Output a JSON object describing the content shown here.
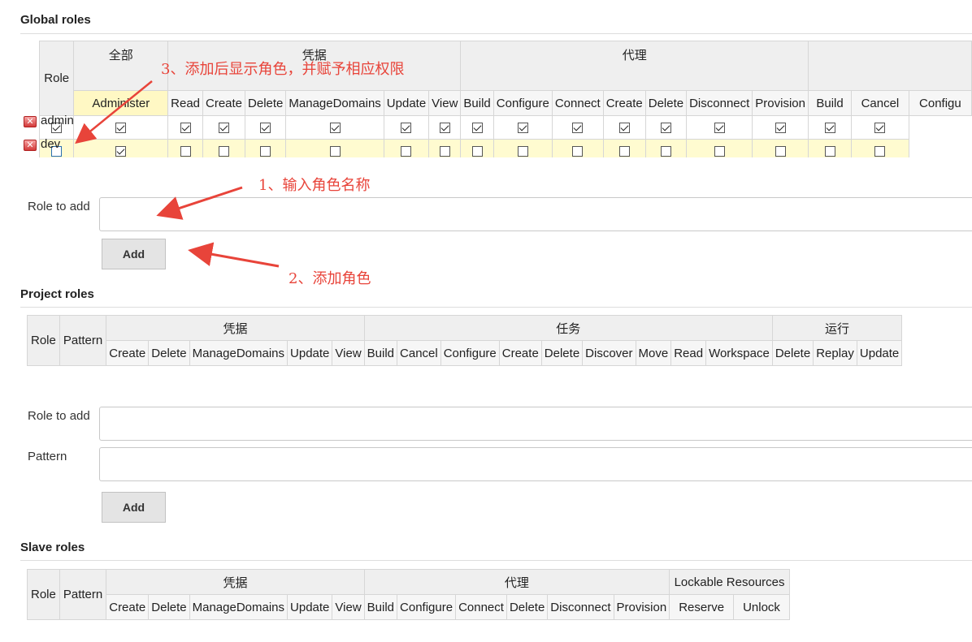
{
  "global": {
    "title": "Global roles",
    "role_header": "Role",
    "groups": [
      "全部",
      "凭据",
      "代理",
      ""
    ],
    "permissions": [
      "Administer",
      "Read",
      "Create",
      "Delete",
      "ManageDomains",
      "Update",
      "View",
      "Build",
      "Configure",
      "Connect",
      "Create",
      "Delete",
      "Disconnect",
      "Provision",
      "Build",
      "Cancel",
      "Configu"
    ],
    "rows": [
      {
        "name": "admin",
        "checks": [
          true,
          true,
          true,
          true,
          true,
          true,
          true,
          true,
          true,
          true,
          true,
          true,
          true,
          true,
          true,
          true,
          true
        ]
      },
      {
        "name": "dev",
        "checks": [
          false,
          true,
          false,
          false,
          false,
          false,
          false,
          false,
          false,
          false,
          false,
          false,
          false,
          false,
          false,
          false,
          false
        ]
      }
    ],
    "role_to_add_label": "Role to add",
    "add_button": "Add"
  },
  "project": {
    "title": "Project roles",
    "role_header": "Role",
    "pattern_header": "Pattern",
    "groups": [
      "凭据",
      "任务",
      "运行"
    ],
    "permissions": [
      "Create",
      "Delete",
      "ManageDomains",
      "Update",
      "View",
      "Build",
      "Cancel",
      "Configure",
      "Create",
      "Delete",
      "Discover",
      "Move",
      "Read",
      "Workspace",
      "Delete",
      "Replay",
      "Update"
    ],
    "role_to_add_label": "Role to add",
    "pattern_label": "Pattern",
    "add_button": "Add"
  },
  "slave": {
    "title": "Slave roles",
    "role_header": "Role",
    "pattern_header": "Pattern",
    "groups": [
      "凭据",
      "代理",
      "Lockable Resources"
    ],
    "permissions": [
      "Create",
      "Delete",
      "ManageDomains",
      "Update",
      "View",
      "Build",
      "Configure",
      "Connect",
      "Delete",
      "Disconnect",
      "Provision",
      "Reserve",
      "Unlock"
    ]
  },
  "annotations": {
    "step1": "1、输入角色名称",
    "step2": "2、添加角色",
    "step3": "3、添加后显示角色，并赋予相应权限"
  },
  "colors": {
    "annotation": "#e8443a",
    "highlight": "#fff8c4",
    "header": "#efefef"
  },
  "icons": {
    "delete": "delete-icon",
    "checkbox": "checkbox-icon"
  }
}
